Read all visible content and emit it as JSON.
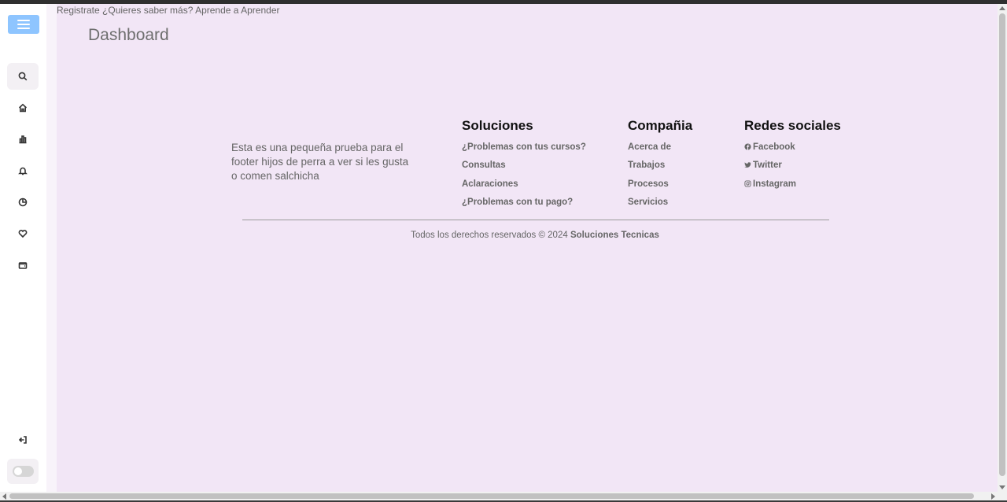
{
  "topbar": {
    "text": "Registrate ¿Quieres saber más? Aprende a Aprender"
  },
  "page": {
    "title": "Dashboard"
  },
  "sidebar": {
    "icons": [
      "menu-icon",
      "search-icon",
      "home-icon",
      "chart-icon",
      "bell-icon",
      "pie-chart-icon",
      "heart-icon",
      "wallet-icon",
      "logout-icon",
      "theme-toggle"
    ],
    "accent": "#8ec5ff"
  },
  "footer": {
    "description": "Esta es una pequeña prueba para el footer hijos de perra a ver si les gusta o comen salchicha",
    "columns": [
      {
        "title": "Soluciones",
        "links": [
          "¿Problemas con tus cursos?",
          "Consultas",
          "Aclaraciones",
          "¿Problemas con tu pago?"
        ]
      },
      {
        "title": "Compañia",
        "links": [
          "Acerca de",
          "Trabajos",
          "Procesos",
          "Servicios"
        ]
      },
      {
        "title": "Redes sociales",
        "links": [
          "Facebook",
          "Twitter",
          "Instagram"
        ],
        "link_icons": [
          "facebook-icon",
          "twitter-icon",
          "instagram-icon"
        ]
      }
    ],
    "copyright_prefix": "Todos los derechos reservados © 2024",
    "copyright_brand": "Soluciones Tecnicas"
  },
  "colors": {
    "background": "#f2e6f6",
    "sidebar": "#ffffff",
    "heading": "#111111",
    "text": "#666666"
  }
}
